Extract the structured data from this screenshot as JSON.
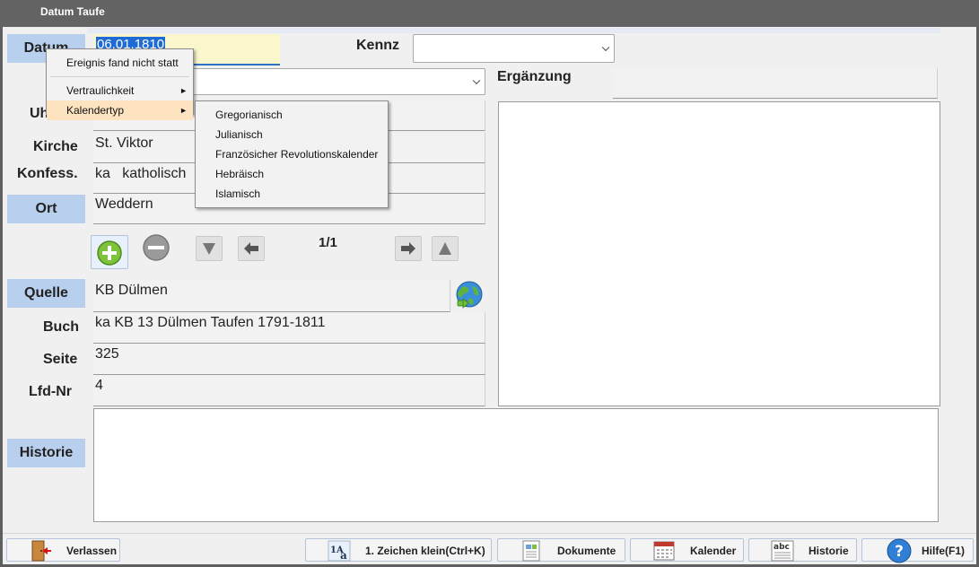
{
  "window": {
    "title": "Datum Taufe"
  },
  "labels": {
    "datum": "Datum",
    "kennz": "Kennz",
    "ergaenzung": "Ergänzung",
    "uhrzeit": "Uh",
    "kirche": "Kirche",
    "konfess": "Konfess.",
    "ort": "Ort",
    "quelle": "Quelle",
    "buch": "Buch",
    "seite": "Seite",
    "lfd_nr": "Lfd-Nr",
    "historie": "Historie"
  },
  "fields": {
    "datum": "06.01.1810",
    "kennz": "",
    "ergaenzung": "",
    "kirche": "St. Viktor",
    "konfess_code": "ka",
    "konfess_name": "katholisch",
    "ort": "Weddern",
    "quelle": "KB Dülmen",
    "buch": "ka KB 13 Dülmen Taufen 1791-1811",
    "seite": "325",
    "lfd_nr": "4"
  },
  "navigation": {
    "counter": "1/1"
  },
  "context_menu": {
    "items": [
      {
        "label": "Ereignis fand nicht statt"
      },
      {
        "label": "Vertraulichkeit",
        "submenu": "►"
      },
      {
        "label": "Kalendertyp",
        "submenu": "►"
      }
    ]
  },
  "calendar_submenu": {
    "items": [
      "Gregorianisch",
      "Julianisch",
      "Französicher Revolutionskalender",
      "Hebräisch",
      "Islamisch"
    ]
  },
  "buttons": {
    "verlassen": "Verlassen",
    "klein": "1. Zeichen klein(Ctrl+K)",
    "dokumente": "Dokumente",
    "kalender": "Kalender",
    "historie": "Historie",
    "hilfe": "Hilfe(F1)"
  },
  "colors": {
    "label_bg": "#b8cfee",
    "highlight": "#fde3c0",
    "date_bg": "#fbf7cc"
  }
}
